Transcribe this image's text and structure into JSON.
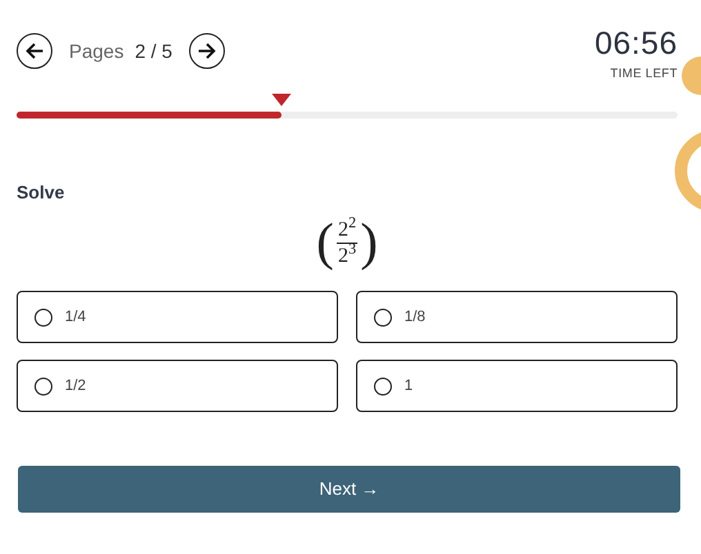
{
  "header": {
    "pages_label": "Pages",
    "current_page": "2",
    "total_pages": "/ 5",
    "timer": "06:56",
    "timer_caption": "TIME LEFT"
  },
  "progress": {
    "level": 0.4
  },
  "question": {
    "prompt": "Solve",
    "open_paren": "(",
    "numerator": "2$^{2}$",
    "denominator": "2$^{3}$",
    "close_paren": ")"
  },
  "options": [
    {
      "label": "1/4",
      "selected": false
    },
    {
      "label": "1/8",
      "selected": false
    },
    {
      "label": "1/2",
      "selected": false
    },
    {
      "label": "1",
      "selected": false
    }
  ],
  "next_button": {
    "label": "Next",
    "arrow": "→"
  }
}
